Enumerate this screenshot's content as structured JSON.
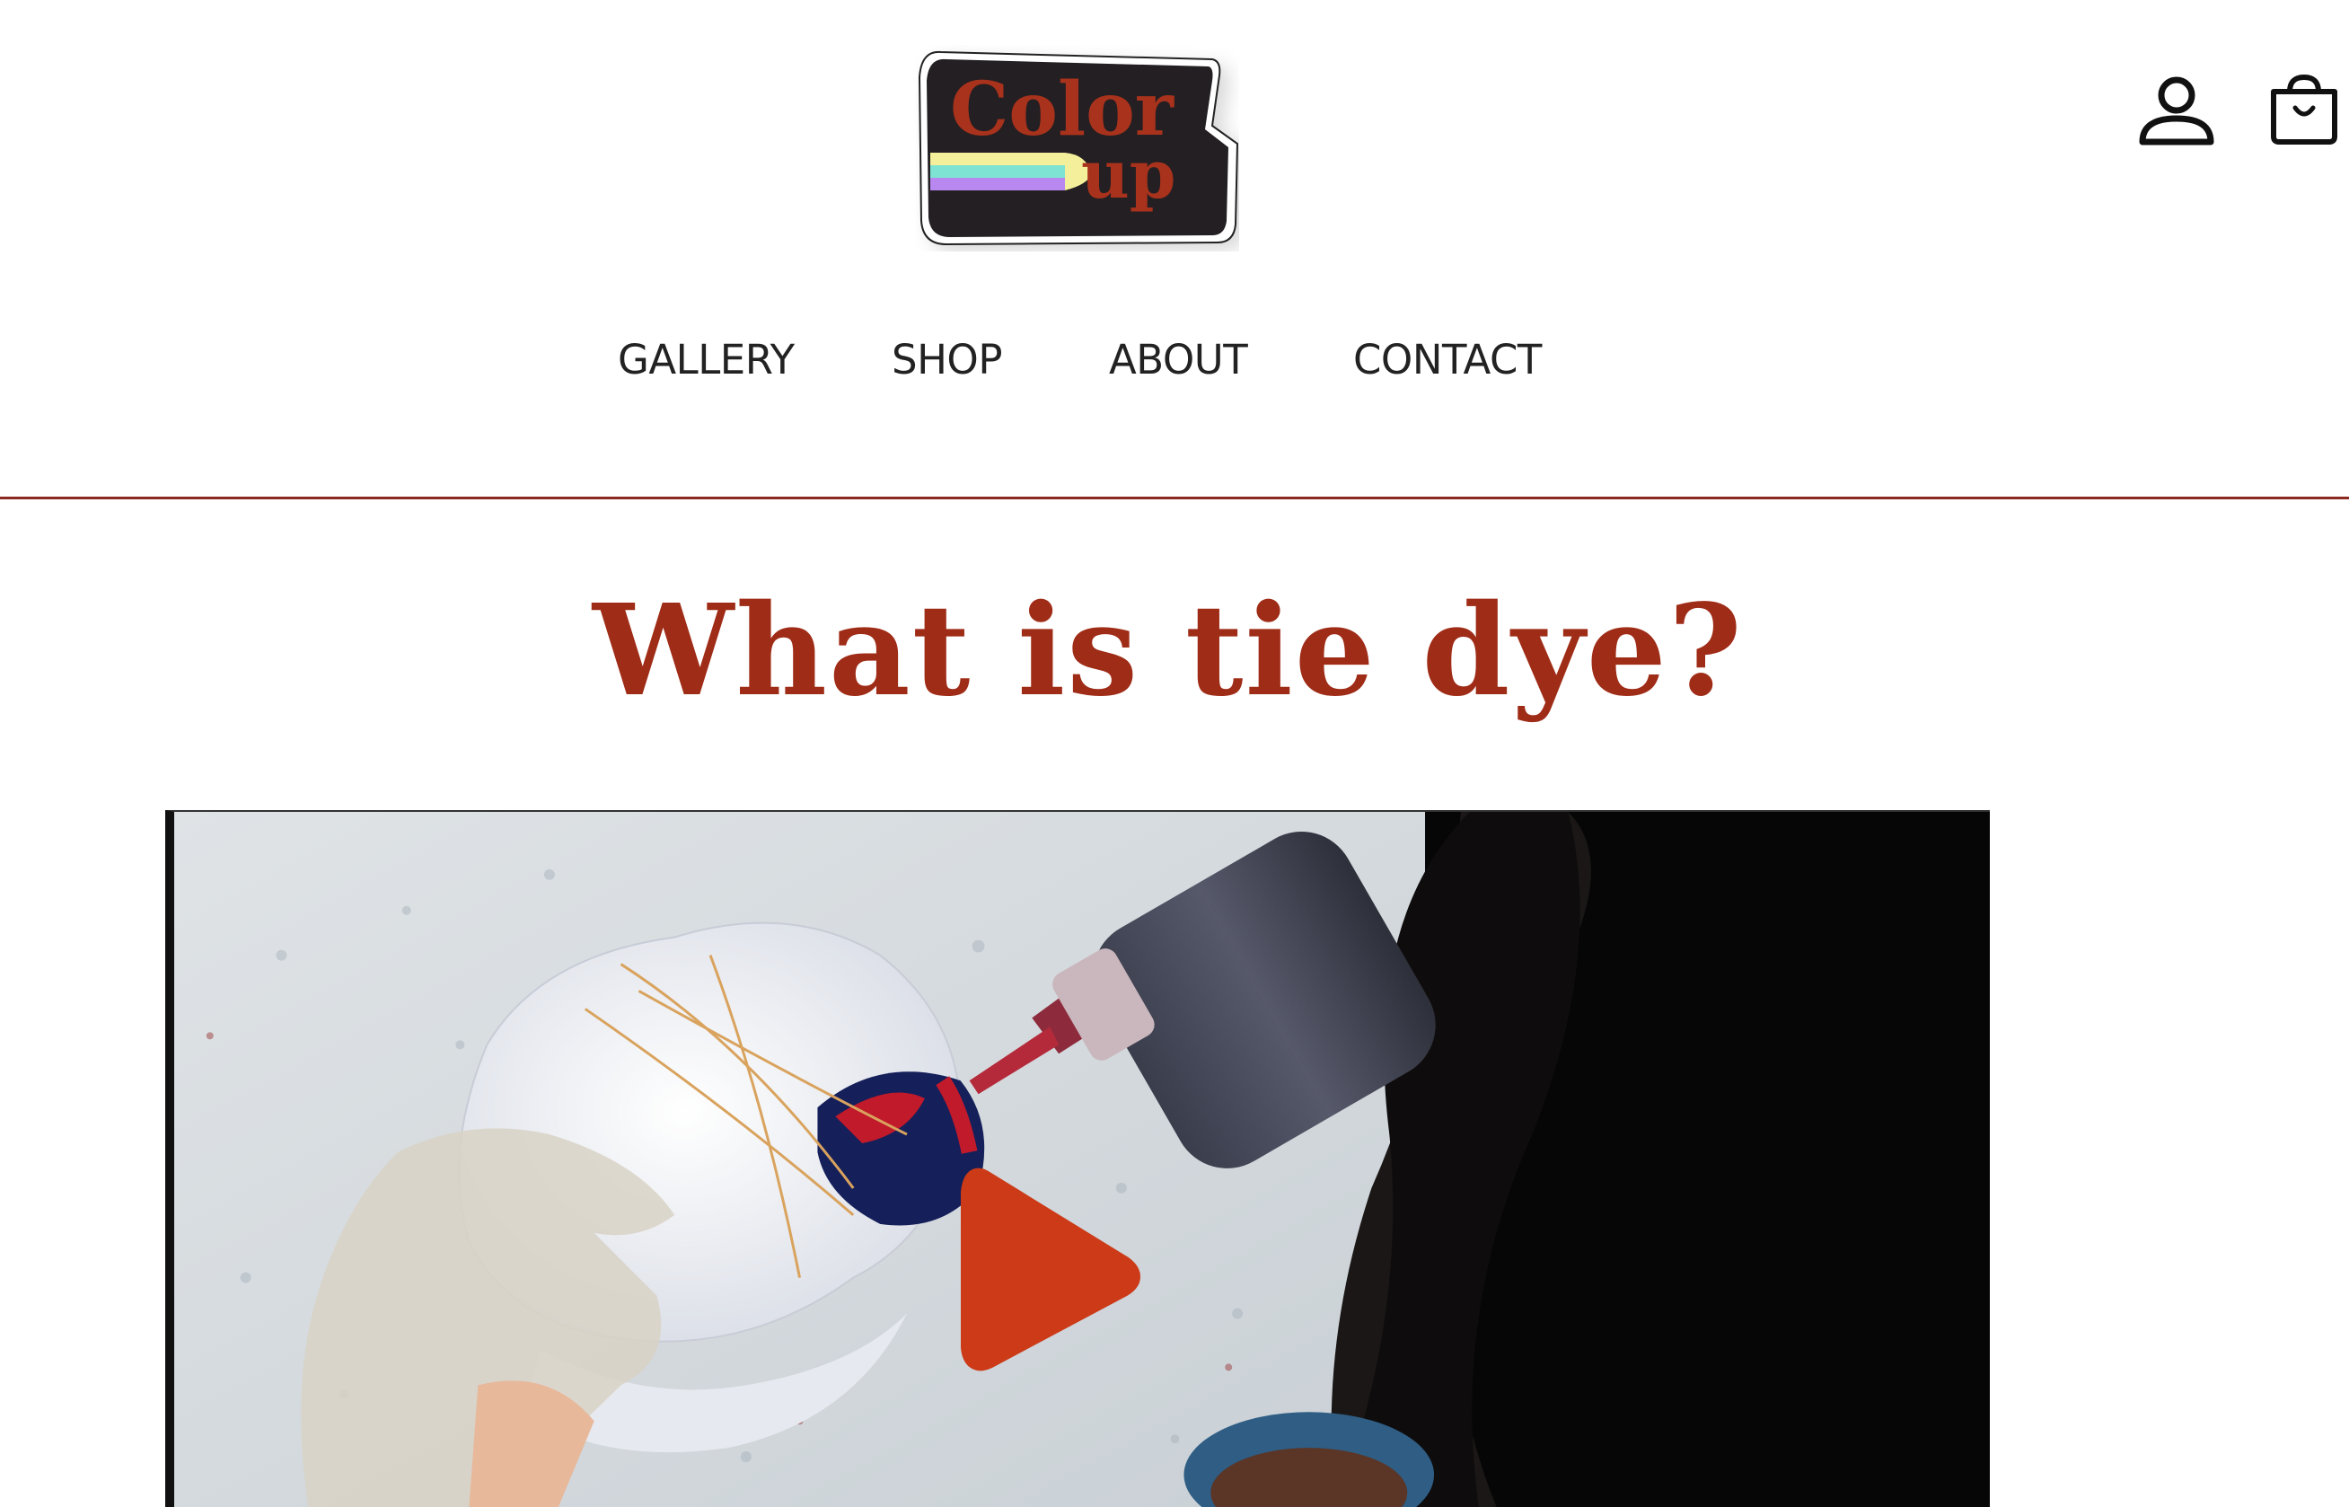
{
  "brand": {
    "logo_line1": "Color",
    "logo_line2": "up",
    "colors": {
      "accent": "#9f2c17",
      "logo_bg": "#231f22",
      "stripe_yellow": "#f3ef9a",
      "stripe_teal": "#7fe3d3",
      "stripe_purple": "#b987f0",
      "play": "#cc3a17",
      "divider": "#8c2a1f"
    }
  },
  "header_icons": {
    "account": "user-icon",
    "cart": "shopping-bag-icon"
  },
  "nav": {
    "gallery": "GALLERY",
    "shop": "SHOP",
    "about": "ABOUT",
    "contact": "CONTACT"
  },
  "main": {
    "title": "What is tie dye?"
  },
  "video": {
    "play_icon": "play-icon"
  }
}
